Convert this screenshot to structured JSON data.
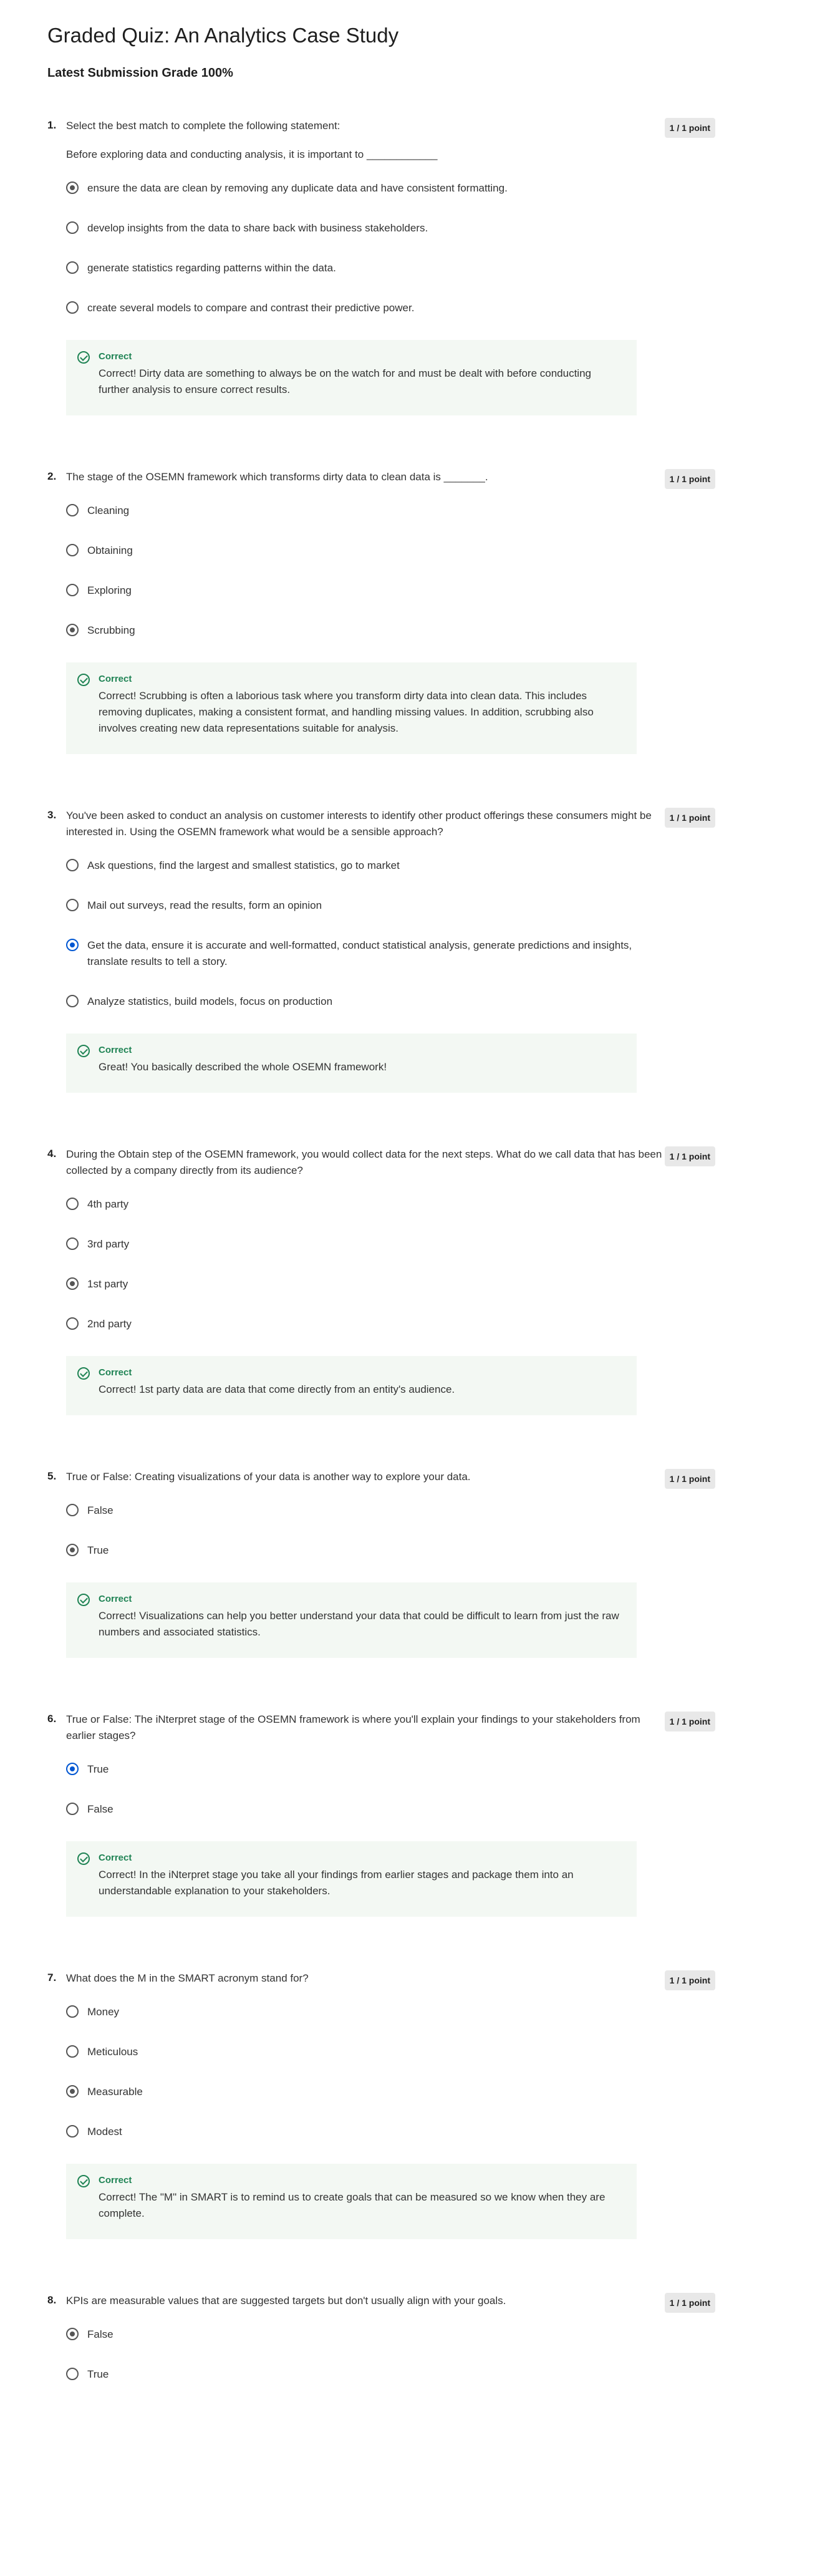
{
  "title": "Graded Quiz: An Analytics Case Study",
  "grade": "Latest Submission Grade 100%",
  "questions": [
    {
      "num": "1.",
      "points": "1 / 1 point",
      "prompt": "Select the best match to complete the following statement:",
      "sub": "Before exploring data and conducting analysis, it is important to ____________",
      "options": [
        {
          "label": "ensure the data are clean by removing any duplicate data and have consistent formatting.",
          "selected": true,
          "blue": false
        },
        {
          "label": "develop insights from the data to share back with business stakeholders.",
          "selected": false,
          "blue": false
        },
        {
          "label": "generate statistics regarding patterns within the data.",
          "selected": false,
          "blue": false
        },
        {
          "label": "create several models to compare and contrast their predictive power.",
          "selected": false,
          "blue": false
        }
      ],
      "feedback_title": "Correct",
      "feedback": "Correct! Dirty data are something to always be on the watch for and must be dealt with before conducting further analysis to ensure correct results."
    },
    {
      "num": "2.",
      "points": "1 / 1 point",
      "prompt": "The stage of the OSEMN framework which transforms dirty data to clean data is _______.",
      "sub": "",
      "options": [
        {
          "label": "Cleaning",
          "selected": false,
          "blue": false
        },
        {
          "label": "Obtaining",
          "selected": false,
          "blue": false
        },
        {
          "label": "Exploring",
          "selected": false,
          "blue": false
        },
        {
          "label": "Scrubbing",
          "selected": true,
          "blue": false
        }
      ],
      "feedback_title": "Correct",
      "feedback": "Correct! Scrubbing is often a laborious task where you transform dirty data into clean data. This includes removing duplicates, making a consistent format, and handling missing values. In addition, scrubbing also involves creating new data representations suitable for analysis."
    },
    {
      "num": "3.",
      "points": "1 / 1 point",
      "prompt": "You've been asked to conduct an analysis on customer interests to identify other product offerings these consumers might be interested in. Using the OSEMN framework what would be a sensible approach?",
      "sub": "",
      "options": [
        {
          "label": "Ask questions, find the largest and smallest statistics, go to market",
          "selected": false,
          "blue": false
        },
        {
          "label": "Mail out surveys, read the results, form an opinion",
          "selected": false,
          "blue": false
        },
        {
          "label": "Get the data, ensure it is accurate and well-formatted, conduct statistical analysis, generate predictions and insights, translate results to tell a story.",
          "selected": true,
          "blue": true
        },
        {
          "label": "Analyze statistics, build models, focus on production",
          "selected": false,
          "blue": false
        }
      ],
      "feedback_title": "Correct",
      "feedback": "Great! You basically described the whole OSEMN framework!"
    },
    {
      "num": "4.",
      "points": "1 / 1 point",
      "prompt": "During the Obtain step of the OSEMN framework, you would collect data for the next steps. What do we call data that has been collected by a company directly from its audience?",
      "sub": "",
      "options": [
        {
          "label": "4th party",
          "selected": false,
          "blue": false
        },
        {
          "label": "3rd party",
          "selected": false,
          "blue": false
        },
        {
          "label": "1st party",
          "selected": true,
          "blue": false
        },
        {
          "label": "2nd party",
          "selected": false,
          "blue": false
        }
      ],
      "feedback_title": "Correct",
      "feedback": "Correct! 1st party data are data that come directly from an entity's audience."
    },
    {
      "num": "5.",
      "points": "1 / 1 point",
      "prompt": "True or False: Creating visualizations of your data is another way to explore your data.",
      "sub": "",
      "options": [
        {
          "label": "False",
          "selected": false,
          "blue": false
        },
        {
          "label": "True",
          "selected": true,
          "blue": false
        }
      ],
      "feedback_title": "Correct",
      "feedback": "Correct! Visualizations can help you better understand your data that could be difficult to learn from just the raw numbers and associated statistics."
    },
    {
      "num": "6.",
      "points": "1 / 1 point",
      "prompt": "True or False: The iNterpret stage of the OSEMN framework is where you'll explain your findings to your stakeholders from earlier stages?",
      "sub": "",
      "options": [
        {
          "label": "True",
          "selected": true,
          "blue": true
        },
        {
          "label": "False",
          "selected": false,
          "blue": false
        }
      ],
      "feedback_title": "Correct",
      "feedback": "Correct! In the iNterpret stage you take all your findings from earlier stages and package them into an understandable explanation to your stakeholders."
    },
    {
      "num": "7.",
      "points": "1 / 1 point",
      "prompt": "What does the M in the SMART acronym stand for?",
      "sub": "",
      "options": [
        {
          "label": "Money",
          "selected": false,
          "blue": false
        },
        {
          "label": "Meticulous",
          "selected": false,
          "blue": false
        },
        {
          "label": "Measurable",
          "selected": true,
          "blue": false
        },
        {
          "label": "Modest",
          "selected": false,
          "blue": false
        }
      ],
      "feedback_title": "Correct",
      "feedback": "Correct! The \"M\" in SMART is to remind us to create goals that can be measured so we know when they are complete."
    },
    {
      "num": "8.",
      "points": "1 / 1 point",
      "prompt": "KPIs are measurable values that are suggested targets but don't usually align with your goals.",
      "sub": "",
      "options": [
        {
          "label": "False",
          "selected": true,
          "blue": false
        },
        {
          "label": "True",
          "selected": false,
          "blue": false
        }
      ],
      "feedback_title": "",
      "feedback": ""
    }
  ]
}
